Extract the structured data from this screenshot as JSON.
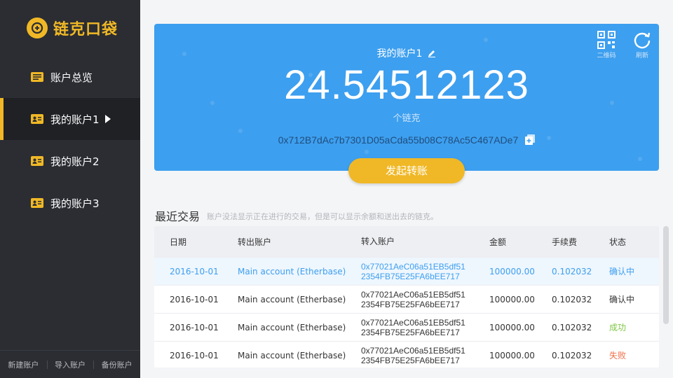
{
  "app": {
    "logo_text": "链克口袋"
  },
  "sidebar": {
    "items": [
      {
        "label": "账户总览"
      },
      {
        "label": "我的账户1"
      },
      {
        "label": "我的账户2"
      },
      {
        "label": "我的账户3"
      }
    ],
    "bottom": [
      "新建账户",
      "导入账户",
      "备份账户"
    ]
  },
  "account": {
    "name": "我的账户1",
    "balance": "24.54512123",
    "unit": "个链克",
    "address": "0x712B7dAc7b7301D05aCda55b08C78Ac5C467ADe7",
    "qr_label": "二维码",
    "refresh_label": "刷新",
    "transfer_label": "发起转账"
  },
  "transactions": {
    "title": "最近交易",
    "note": "账户没法显示正在进行的交易，但是可以显示余额和送出去的链克。",
    "headers": [
      "日期",
      "转出账户",
      "转入账户",
      "金额",
      "手续费",
      "状态"
    ],
    "rows": [
      {
        "date": "2016-10-01",
        "from": "Main account (Etherbase)",
        "to_1": "0x77021AeC06a51EB5df51",
        "to_2": "2354FB75E25FA6bEE717",
        "amount": "100000.00",
        "fee": "0.102032",
        "status": "确认中"
      },
      {
        "date": "2016-10-01",
        "from": "Main account (Etherbase)",
        "to_1": "0x77021AeC06a51EB5df51",
        "to_2": "2354FB75E25FA6bEE717",
        "amount": "100000.00",
        "fee": "0.102032",
        "status": "确认中"
      },
      {
        "date": "2016-10-01",
        "from": "Main account (Etherbase)",
        "to_1": "0x77021AeC06a51EB5df51",
        "to_2": "2354FB75E25FA6bEE717",
        "amount": "100000.00",
        "fee": "0.102032",
        "status": "成功"
      },
      {
        "date": "2016-10-01",
        "from": "Main account (Etherbase)",
        "to_1": "0x77021AeC06a51EB5df51",
        "to_2": "2354FB75E25FA6bEE717",
        "amount": "100000.00",
        "fee": "0.102032",
        "status": "失败"
      }
    ]
  },
  "colors": {
    "accent": "#f0b826",
    "card": "#3d9fef",
    "sidebar": "#2b2d33",
    "success": "#7ec544",
    "fail": "#f0704a"
  }
}
